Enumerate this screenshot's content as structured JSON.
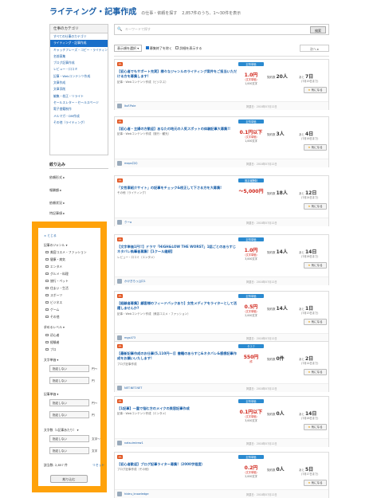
{
  "header": {
    "title": "ライティング・記事作成",
    "subtitle": "の仕事・依頼を探す",
    "count": "2,857件のうち、1〜30件を表示"
  },
  "sidebar": {
    "category_title": "仕事のカテゴリ",
    "categories": [
      "すべての仕事のカテゴリ",
      "ライティング・記事作成",
      "キャッチフレーズ・コピー・ライティング",
      "名前募集",
      "ブログ記事作成",
      "レビュー・口コミ",
      "記事・Webコンテンツ作成",
      "文章作成",
      "文章添削",
      "編集・校正・リライト",
      "セールスレター・セールスページ",
      "電子書籍制作",
      "メルマガ・DM作成",
      "その他（ライティング）"
    ],
    "filter_title": "絞り込み",
    "filters": [
      "依頼形式 ▸",
      "報酬額 ▸",
      "依頼状況 ▸",
      "特記事項 ▸"
    ]
  },
  "panel": {
    "close": "× とじる",
    "genre_title": "記事のジャンル ▾",
    "genres": [
      "美容コスメ・ファッション",
      "健康・病気",
      "エンタメ",
      "グルメ・料理",
      "旅行・ペット",
      "住まい・生活",
      "スポーツ",
      "ビジネス",
      "ゲーム",
      "その他"
    ],
    "level_title": "求めるレベル ▾",
    "levels": [
      "初心者",
      "経験者",
      "プロ"
    ],
    "unit_title": "文字単価 ▾",
    "unit_rows": [
      {
        "select": "指定しない",
        "unit": "円〜"
      },
      {
        "select": "指定しない",
        "unit": "円"
      }
    ],
    "price_title": "記事単価 ▾",
    "price_rows": [
      {
        "select": "指定しない",
        "unit": "円〜"
      },
      {
        "select": "指定しない",
        "unit": "円"
      }
    ],
    "chars_title": "文字数（1記事あたり） ▾",
    "chars_rows": [
      {
        "select": "指定しない",
        "unit": "文字〜"
      },
      {
        "select": "指定しない",
        "unit": "文字"
      }
    ],
    "result": "該当数: 2,857 件",
    "reset": "リセット",
    "search_button": "絞り込む"
  },
  "search": {
    "placeholder": "キーワードで探す",
    "button": "検索"
  },
  "sort": {
    "label": "表示順を選択 ▾",
    "opt1": "募集終了を除く",
    "opt2": "詳細を表示する",
    "pager": "次へ ▸"
  },
  "jobs": [
    {
      "badge": "PR",
      "title": "【初心者でもサポート充実】様々なジャンルのライティング案件をご担当いただける方を募集します!",
      "cat": "記事・Webコンテンツ作成（ビジネス）",
      "ptag": "記事単価",
      "price": "1.0円",
      "psub": "（文字単価）",
      "pwords": "1,000文字",
      "contracts": "20",
      "apps": "20人",
      "days": "7日",
      "due": "(7月19日まで)",
      "fav": "気になる",
      "user": "ItoF.Pole",
      "posted": "掲載日：2018年07月12日"
    },
    {
      "badge": "PR",
      "title": "【初心者・主婦の方歓迎】あなたの地元の人気スポットの体験記事大募集!!",
      "cat": "記事・Webコンテンツ作成（旅行・観光）",
      "ptag": "記事単価",
      "price": "0.1円以下",
      "psub": "（文字単価）",
      "pwords": "1,000文字",
      "contracts": "3",
      "apps": "3人",
      "days": "4日",
      "due": "(7月16日まで)",
      "fav": "気になる",
      "user": "maps口の",
      "posted": "掲載日：2018年07月12日"
    },
    {
      "badge": "PR",
      "title": "「女性車紹介サイト」の記事をチェック&校正して下さる方を大募集!",
      "cat": "その他（ライティング）",
      "ptag": "固定報酬制",
      "price": "〜5,000円",
      "psub": "",
      "pwords": "",
      "contracts": "18",
      "apps": "18人",
      "days": "12日",
      "due": "(7月24日まで)",
      "fav": "気になる",
      "user": "クーa",
      "posted": "掲載日：2018年07月12日"
    },
    {
      "badge": "PR",
      "title": "【文字単価1円!!】ドラマ「HiGH&LOW THE WORST」1話ごとのあらすじネタバレ執筆者募集!【1クール継続】",
      "cat": "レビュー・口コミ（エンタメ）",
      "ptag": "記事単価",
      "price": "1.0円",
      "psub": "（文字単価）",
      "pwords": "3,000文字",
      "contracts": "14",
      "apps": "14人",
      "days": "14日",
      "due": "(7月26日まで)",
      "fav": "気になる",
      "user": "かけぎろっ山口1",
      "posted": "掲載日：2018年07月12日"
    },
    {
      "badge": "PR",
      "title": "【経験者募集】顧客様のフィードバックあり】女性メディアをライターとして活躍しませんか?",
      "cat": "記事・Webコンテンツ作成（美容コスメ・ファッション）",
      "ptag": "記事単価",
      "price": "0.5円",
      "psub": "（文字単価）",
      "pwords": "2,000文字",
      "contracts": "14",
      "apps": "14人",
      "days": "1日",
      "due": "(7月13日まで)",
      "fav": "気になる",
      "user": "mgs473",
      "posted": "掲載日：2018年07月12日"
    },
    {
      "badge": "PR",
      "title": "【最新記事作成のお仕事(5,110円～)】書籍のあらすじ&ネタバレ&感想記事作成をお願いいたします!",
      "cat": "ブログ記事作成",
      "ptag": "タスク",
      "price": "550円",
      "psub": "/件",
      "pwords": "",
      "contracts": "0",
      "apps": "0件",
      "days": "2日",
      "due": "(7月14日まで)",
      "fav": "気になる",
      "user": "NET.NET.NET",
      "posted": "掲載日：2018年07月12日"
    },
    {
      "badge": "PR",
      "title": "【1記事】一重で悩む方のメイクの美容記事作成",
      "cat": "記事・Webコンテンツ作成（エンタメ）",
      "ptag": "記事単価",
      "price": "0.1円以下",
      "psub": "（文字単価）",
      "pwords": "3,000文字",
      "contracts": "0",
      "apps": "0人",
      "days": "14日",
      "due": "(7月26日まで)",
      "fav": "気になる",
      "user": "natsuimirew1",
      "posted": "掲載日：2018年07月12日"
    },
    {
      "badge": "PR",
      "title": "【初心者歓迎】ブログ記事ライター募集!（2000字程度）",
      "cat": "ブログ記事作成（その他）",
      "ptag": "記事単価",
      "price": "0.2円",
      "psub": "（文字単価）",
      "pwords": "2,000文字",
      "contracts": "0",
      "apps": "0人",
      "days": "5日",
      "due": "(7月17日まで)",
      "fav": "気になる",
      "user": "hideu_knowledge",
      "posted": "掲載日：2018年07月12日"
    }
  ],
  "labels": {
    "contracts": "契約数",
    "apps": "応募した人",
    "days": "あと"
  }
}
